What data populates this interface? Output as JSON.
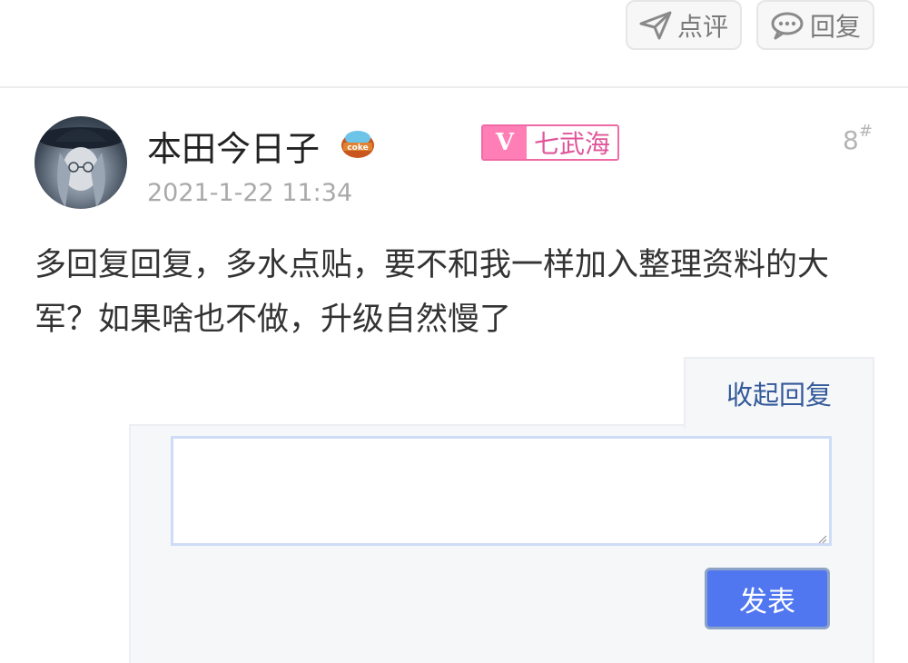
{
  "toolbar": {
    "rate_label": "点评",
    "reply_label": "回复"
  },
  "post": {
    "username": "本田今日子",
    "badge_icon": "coke-medal-icon",
    "timestamp": "2021-1-22 11:34",
    "rank_badge": {
      "prefix": "V",
      "label": "七武海"
    },
    "floor": "8",
    "floor_suffix": "#",
    "body": "多回复回复，多水点贴，要不和我一样加入整理资料的大军？如果啥也不做，升级自然慢了"
  },
  "reply_panel": {
    "collapse_label": "收起回复",
    "input_value": "",
    "submit_label": "发表"
  },
  "colors": {
    "accent_blue": "#5177f0",
    "link_blue": "#335a9a",
    "rank_pink": "#ff7eb6",
    "muted_gray": "#a9a9a9"
  }
}
